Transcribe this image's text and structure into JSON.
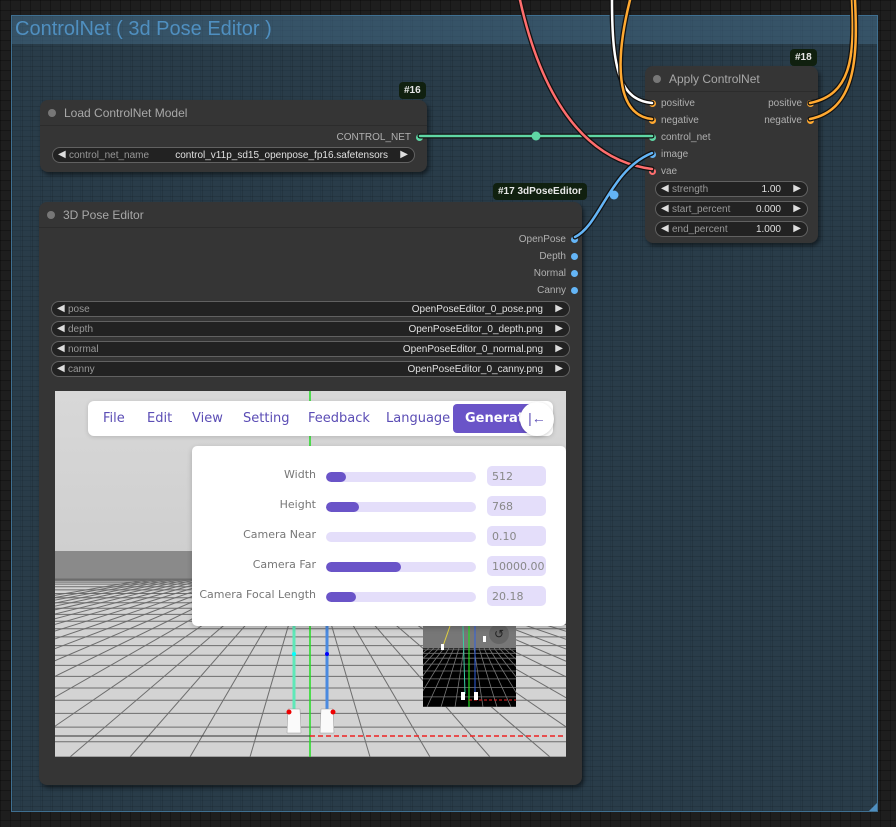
{
  "group": {
    "title": "ControlNet ( 3d Pose Editor )"
  },
  "nodes": {
    "load_controlnet": {
      "badge": "#16",
      "title": "Load ControlNet Model",
      "output": "CONTROL_NET",
      "widget": {
        "label": "control_net_name",
        "value": "control_v11p_sd15_openpose_fp16.safetensors"
      }
    },
    "apply_controlnet": {
      "badge": "#18",
      "title": "Apply ControlNet",
      "inputs": [
        "positive",
        "negative",
        "control_net",
        "image",
        "vae"
      ],
      "outputs": [
        "positive",
        "negative"
      ],
      "widgets": [
        {
          "label": "strength",
          "value": "1.00"
        },
        {
          "label": "start_percent",
          "value": "0.000"
        },
        {
          "label": "end_percent",
          "value": "1.000"
        }
      ]
    },
    "pose_editor": {
      "badge": "#17 3dPoseEditor",
      "title": "3D Pose Editor",
      "outputs": [
        "OpenPose",
        "Depth",
        "Normal",
        "Canny"
      ],
      "widgets": [
        {
          "label": "pose",
          "value": "OpenPoseEditor_0_pose.png"
        },
        {
          "label": "depth",
          "value": "OpenPoseEditor_0_depth.png"
        },
        {
          "label": "normal",
          "value": "OpenPoseEditor_0_normal.png"
        },
        {
          "label": "canny",
          "value": "OpenPoseEditor_0_canny.png"
        }
      ]
    }
  },
  "editor": {
    "menu": [
      "File",
      "Edit",
      "View",
      "Setting",
      "Feedback",
      "Language"
    ],
    "generate_label": "Generate",
    "collapse_icon": "|←",
    "settings": [
      {
        "label": "Width",
        "value": "512",
        "fill": 0.13
      },
      {
        "label": "Height",
        "value": "768",
        "fill": 0.22
      },
      {
        "label": "Camera Near",
        "value": "0.10",
        "fill": 0.0
      },
      {
        "label": "Camera Far",
        "value": "10000.00",
        "fill": 0.5
      },
      {
        "label": "Camera Focal Length",
        "value": "20.18",
        "fill": 0.2
      }
    ],
    "undo_icon": "↺"
  },
  "colors": {
    "control_net": "#5fd7a5",
    "conditioning": "#ffa931",
    "image": "#64b5f6",
    "vae": "#ff6e6e",
    "accent": "#6a54c8"
  }
}
